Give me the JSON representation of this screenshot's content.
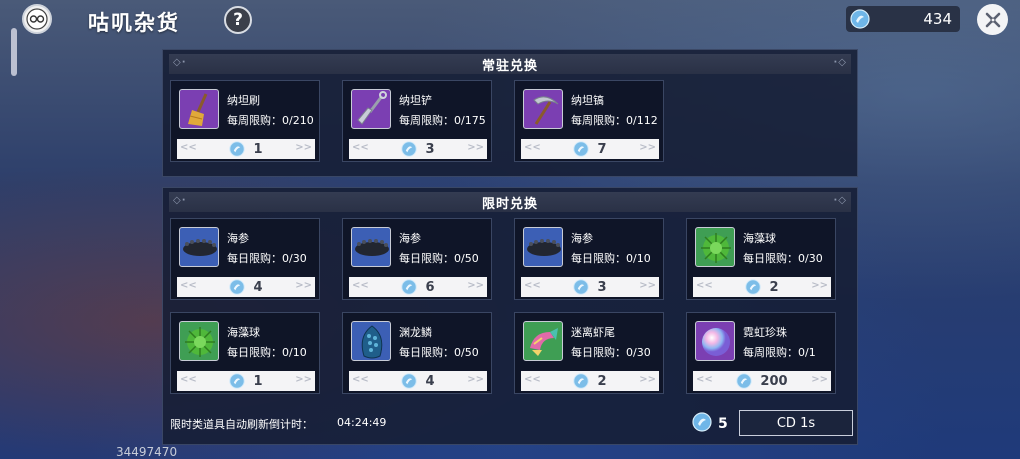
{
  "header": {
    "title": "咕叽杂货",
    "help_label": "?",
    "currency_amount": "434"
  },
  "permanent": {
    "title": "常驻兑换",
    "items": [
      {
        "name": "纳坦刷",
        "limit": "每周限购：0/210",
        "price": "1",
        "icon": "broom-icon",
        "color": "#7b3fb2"
      },
      {
        "name": "纳坦铲",
        "limit": "每周限购：0/175",
        "price": "3",
        "icon": "shovel-icon",
        "color": "#7b3fb2"
      },
      {
        "name": "纳坦镐",
        "limit": "每周限购：0/112",
        "price": "7",
        "icon": "pickaxe-icon",
        "color": "#7b3fb2"
      }
    ]
  },
  "limited": {
    "title": "限时兑换",
    "items": [
      {
        "name": "海参",
        "limit": "每日限购：0/30",
        "price": "4",
        "icon": "sea-cucumber-icon",
        "color": "#3c5fb5"
      },
      {
        "name": "海参",
        "limit": "每日限购：0/50",
        "price": "6",
        "icon": "sea-cucumber-icon",
        "color": "#3c5fb5"
      },
      {
        "name": "海参",
        "limit": "每日限购：0/10",
        "price": "3",
        "icon": "sea-cucumber-icon",
        "color": "#3c5fb5"
      },
      {
        "name": "海藻球",
        "limit": "每日限购：0/30",
        "price": "2",
        "icon": "seaweed-ball-icon",
        "color": "#3f9e54"
      },
      {
        "name": "海藻球",
        "limit": "每日限购：0/10",
        "price": "1",
        "icon": "seaweed-ball-icon",
        "color": "#3f9e54"
      },
      {
        "name": "渊龙鳞",
        "limit": "每日限购：0/50",
        "price": "4",
        "icon": "dragon-scale-icon",
        "color": "#3c5fb5"
      },
      {
        "name": "迷离虾尾",
        "limit": "每日限购：0/30",
        "price": "2",
        "icon": "shrimp-tail-icon",
        "color": "#3f9e54"
      },
      {
        "name": "霓虹珍珠",
        "limit": "每周限购：0/1",
        "price": "200",
        "icon": "pearl-icon",
        "color": "#7b3fb2"
      }
    ]
  },
  "footer": {
    "refresh_label": "限时类道具自动刷新倒计时：",
    "refresh_timer": "04:24:49",
    "refresh_cost": "5",
    "cd_label": "CD 1s"
  },
  "uid": "34497470"
}
